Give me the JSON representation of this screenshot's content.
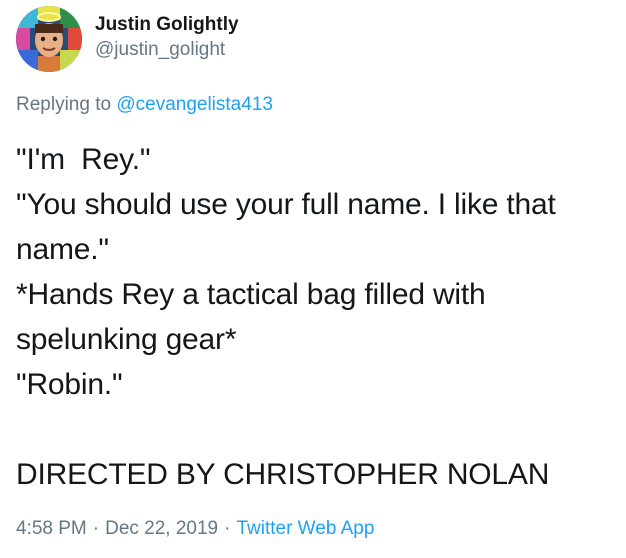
{
  "author": {
    "display_name": "Justin Golightly",
    "handle": "@justin_golight",
    "avatar_icon": "profile-photo"
  },
  "reply": {
    "prefix": "Replying to ",
    "to_handle": "@cevangelista413"
  },
  "tweet": {
    "lines": [
      "\"I'm  Rey.\"",
      "\"You should use your full name. I like that",
      "name.\"",
      "*Hands Rey a tactical bag filled with",
      "spelunking gear*",
      "\"Robin.\"",
      "",
      "DIRECTED BY CHRISTOPHER NOLAN"
    ]
  },
  "meta": {
    "time": "4:58 PM",
    "separator": "·",
    "date": "Dec 22, 2019",
    "source": "Twitter Web App"
  },
  "colors": {
    "text": "#14171a",
    "secondary": "#657786",
    "link": "#1da1f2"
  }
}
